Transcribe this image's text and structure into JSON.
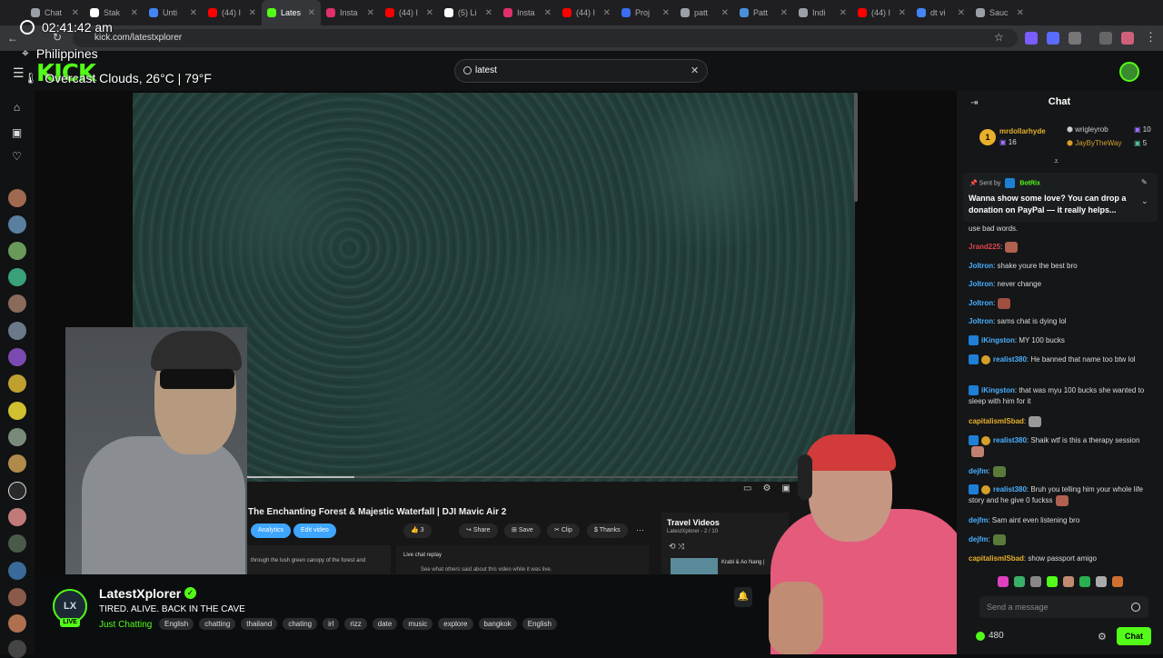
{
  "browser": {
    "tabs": [
      {
        "label": "Chat",
        "color": "#9aa0a6"
      },
      {
        "label": "Stak",
        "color": "#ffffff"
      },
      {
        "label": "Unti",
        "color": "#4285f4"
      },
      {
        "label": "(44) I",
        "color": "#ff0000"
      },
      {
        "label": "Lates",
        "color": "#53fc18",
        "active": true
      },
      {
        "label": "Insta",
        "color": "#e1306c"
      },
      {
        "label": "(44) I",
        "color": "#ff0000"
      },
      {
        "label": "(5) Li",
        "color": "#ffffff"
      },
      {
        "label": "Insta",
        "color": "#e1306c"
      },
      {
        "label": "(44) I",
        "color": "#ff0000"
      },
      {
        "label": "Proj",
        "color": "#3a6df0"
      },
      {
        "label": "patt",
        "color": "#9aa0a6"
      },
      {
        "label": "Patt",
        "color": "#4a90d9"
      },
      {
        "label": "Indi",
        "color": "#9aa0a6"
      },
      {
        "label": "(44) I",
        "color": "#ff0000"
      },
      {
        "label": "dt vi",
        "color": "#4285f4"
      },
      {
        "label": "Sauc",
        "color": "#9aa0a6"
      }
    ],
    "url": "kick.com/latestxplorer"
  },
  "overlay": {
    "time": "02:41:42 am",
    "location": "Philippines",
    "weather": "Overcast Clouds, 26°C | 79°F"
  },
  "header": {
    "logo": "KICK",
    "search_value": "latest"
  },
  "video": {
    "yt_title": "The Enchanting Forest & Majestic Waterfall | DJI Mavic Air 2",
    "analytics_label": "Analytics",
    "edit_label": "Edit video",
    "like_count": "3",
    "share_label": "Share",
    "save_label": "Save",
    "clip_label": "Clip",
    "thanks_label": "Thanks",
    "desc_snippet": "through the lush green canopy of the forest and",
    "live_chat_replay": "Live chat replay",
    "live_chat_sub": "See what others said about this video while it was live.",
    "travel_title": "Travel Videos",
    "travel_sub": "LatestXplorer - 2 / 10",
    "travel_item": "Krabi & Ao Nang |"
  },
  "channel": {
    "name": "LatestXplorer",
    "avatar_text": "LX",
    "live_badge": "LIVE",
    "stream_title": "TIRED. ALIVE. BACK IN THE CAVE",
    "category": "Just Chatting",
    "tags": [
      "English",
      "chatting",
      "thailand",
      "chating",
      "irl",
      "rizz",
      "date",
      "music",
      "explore",
      "bangkok",
      "English"
    ]
  },
  "chat": {
    "title": "Chat",
    "leaderboard": [
      {
        "rank": "1",
        "name": "mrdollarhyde",
        "count": "16",
        "color": "#e8b02a"
      },
      {
        "name": "wrigleyrob",
        "count": "10",
        "color": "#cccccc"
      },
      {
        "name": "JayByTheWay",
        "count": "5",
        "color": "#d4a02a"
      }
    ],
    "pinned": {
      "sent_by": "Sent by",
      "bot": "BotRix",
      "text": "Wanna show some love? You can drop a donation on PayPal — it really helps..."
    },
    "messages": [
      {
        "user": "",
        "text": "use bad words.",
        "color": "#dddddd"
      },
      {
        "user": "Jrand225",
        "text": ":",
        "color": "#e0454d",
        "emote": "#b06050"
      },
      {
        "user": "Joltron",
        "text": ": shake youre the best bro",
        "color": "#4ab0ff"
      },
      {
        "user": "Joltron",
        "text": ": never change",
        "color": "#4ab0ff"
      },
      {
        "user": "Joltron",
        "text": ":",
        "color": "#4ab0ff",
        "emote": "#a05040"
      },
      {
        "user": "Joltron",
        "text": ": sams chat is dying lol",
        "color": "#4ab0ff"
      },
      {
        "user": "iKingston",
        "text": ": MY 100 bucks",
        "color": "#4ab0ff",
        "badge": "b"
      },
      {
        "user": "realist380",
        "text": ": He banned that name too btw lol",
        "color": "#4ab0ff",
        "badge": "bc"
      },
      {
        "user": "iKingston",
        "text": ": that was myu 100 bucks she wanted to sleep with him for it",
        "color": "#4ab0ff",
        "badge": "b"
      },
      {
        "user": "capitalismISbad",
        "text": ":",
        "color": "#e8b02a",
        "emote": "#999999"
      },
      {
        "user": "realist380",
        "text": ": Shaik wtf is this a therapy session",
        "color": "#4ab0ff",
        "badge": "bc",
        "emote": "#c08070"
      },
      {
        "user": "dejfm",
        "text": ":",
        "color": "#4ab0ff",
        "emote": "#5a7a3a"
      },
      {
        "user": "realist380",
        "text": ": Bruh you telling him your whole life story and he give 0 fuckss",
        "color": "#4ab0ff",
        "badge": "bc",
        "emote": "#b06050"
      },
      {
        "user": "dejfm",
        "text": ": Sam aint even listening bro",
        "color": "#4ab0ff"
      },
      {
        "user": "dejfm",
        "text": ":",
        "color": "#4ab0ff",
        "emote": "#5a7a3a"
      },
      {
        "user": "capitalismISbad",
        "text": ": show passport amigo",
        "color": "#e8b02a"
      }
    ],
    "input_placeholder": "Send a message",
    "points": "480",
    "chat_button": "Chat"
  }
}
